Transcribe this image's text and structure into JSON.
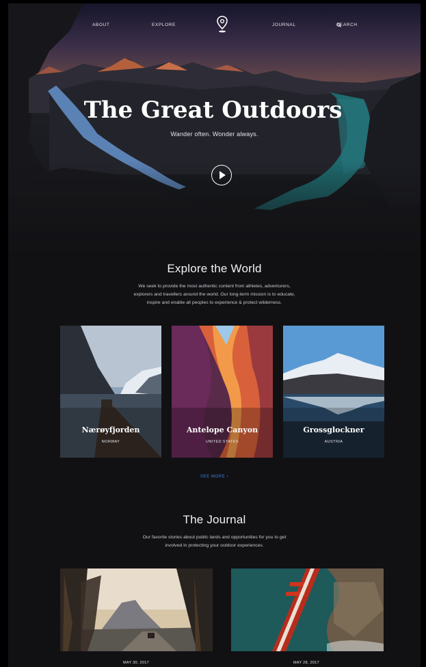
{
  "nav": {
    "about": "ABOUT",
    "explore": "EXPLORE",
    "journal": "JOURNAL",
    "search": "SEARCH",
    "logo_icon": "location-pin-icon"
  },
  "hero": {
    "title": "The Great Outdoors",
    "subtitle": "Wander often. Wonder always.",
    "play_icon": "play-icon"
  },
  "explore": {
    "title": "Explore the World",
    "description": [
      "We seek to provide the most authentic content from athletes, adventurers,",
      "explorers and travellers around the world. Our long-term mission is to educate,",
      "inspire and enable all peoples to experience & protect wilderness."
    ],
    "cards": [
      {
        "name": "Nærøyfjorden",
        "country": "NORWAY"
      },
      {
        "name": "Antelope Canyon",
        "country": "UNITED STATES"
      },
      {
        "name": "Grossglockner",
        "country": "AUSTRIA"
      }
    ],
    "see_more": "SEE MORE  ›"
  },
  "journal": {
    "title": "The Journal",
    "description": [
      "Our favorite stories about public lands and opportunities for you to get",
      "involved in protecting your outdoor experiences."
    ],
    "posts": [
      {
        "date": "MAY 30, 2017"
      },
      {
        "date": "MAY 28, 2017"
      }
    ]
  },
  "colors": {
    "background": "#111114",
    "accent_link": "#3d7fe0",
    "text": "#ffffff"
  }
}
